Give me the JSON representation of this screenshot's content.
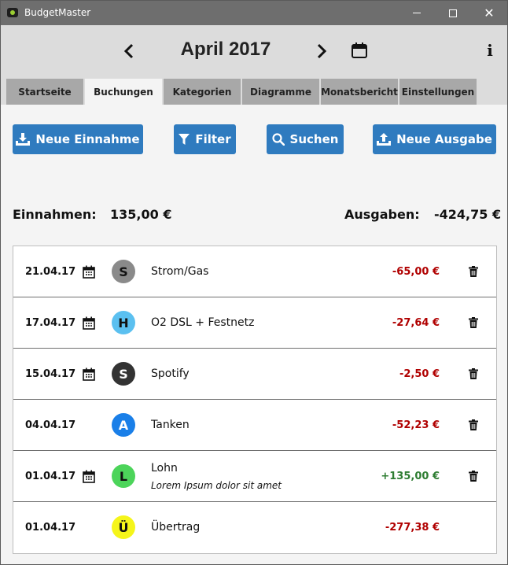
{
  "window": {
    "title": "BudgetMaster",
    "close_glyph": "✕"
  },
  "header": {
    "month": "April 2017",
    "info_glyph": "i"
  },
  "tabs": [
    {
      "label": "Startseite",
      "active": false
    },
    {
      "label": "Buchungen",
      "active": true
    },
    {
      "label": "Kategorien",
      "active": false
    },
    {
      "label": "Diagramme",
      "active": false
    },
    {
      "label": "Monatsbericht",
      "active": false
    },
    {
      "label": "Einstellungen",
      "active": false
    }
  ],
  "toolbar": {
    "new_income": "Neue Einnahme",
    "filter": "Filter",
    "search": "Suchen",
    "new_expense": "Neue Ausgabe"
  },
  "summary": {
    "income_label": "Einnahmen:",
    "income_value": "135,00 €",
    "expense_label": "Ausgaben:",
    "expense_value": "-424,75 €"
  },
  "colors": {
    "accent": "#2f7bbf",
    "negative": "#b00000",
    "positive": "#2e7d32"
  },
  "transactions": [
    {
      "date": "21.04.17",
      "repeating": true,
      "letter": "S",
      "badge_color": "#8a8a8a",
      "letter_color": "#111111",
      "name": "Strom/Gas",
      "description": "",
      "amount": "-65,00 €",
      "type": "neg",
      "deletable": true
    },
    {
      "date": "17.04.17",
      "repeating": true,
      "letter": "H",
      "badge_color": "#5bc0f0",
      "letter_color": "#111111",
      "name": "O2 DSL + Festnetz",
      "description": "",
      "amount": "-27,64 €",
      "type": "neg",
      "deletable": true
    },
    {
      "date": "15.04.17",
      "repeating": true,
      "letter": "S",
      "badge_color": "#333333",
      "letter_color": "#ffffff",
      "name": "Spotify",
      "description": "",
      "amount": "-2,50 €",
      "type": "neg",
      "deletable": true
    },
    {
      "date": "04.04.17",
      "repeating": false,
      "letter": "A",
      "badge_color": "#1a7fe8",
      "letter_color": "#ffffff",
      "name": "Tanken",
      "description": "",
      "amount": "-52,23 €",
      "type": "neg",
      "deletable": true
    },
    {
      "date": "01.04.17",
      "repeating": true,
      "letter": "L",
      "badge_color": "#4cd45a",
      "letter_color": "#111111",
      "name": "Lohn",
      "description": "Lorem Ipsum dolor sit amet",
      "amount": "+135,00 €",
      "type": "pos",
      "deletable": true
    },
    {
      "date": "01.04.17",
      "repeating": false,
      "letter": "Ü",
      "badge_color": "#f5f51a",
      "letter_color": "#111111",
      "name": "Übertrag",
      "description": "",
      "amount": "-277,38 €",
      "type": "neg",
      "deletable": false
    }
  ]
}
